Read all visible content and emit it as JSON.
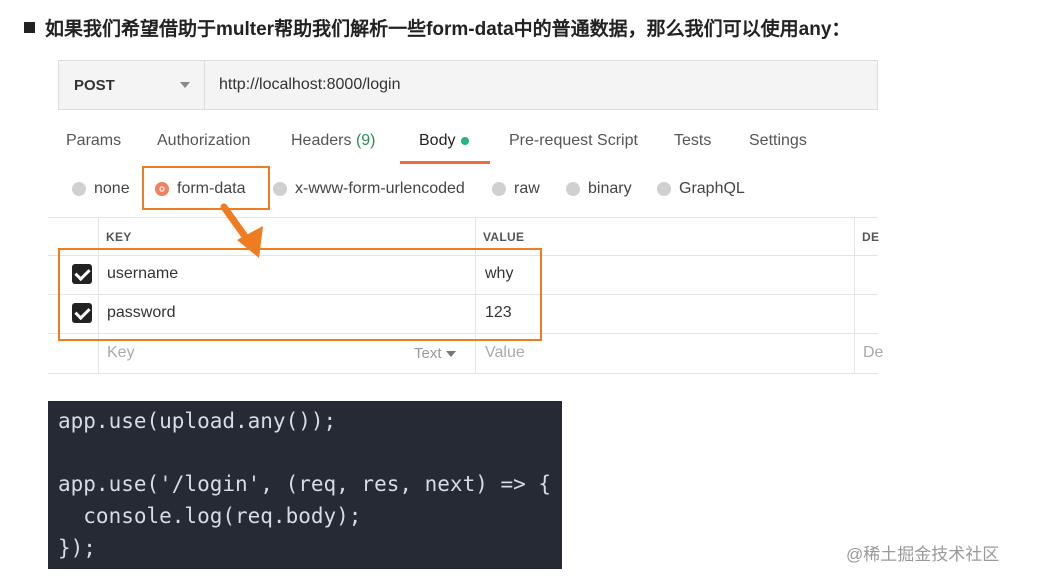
{
  "heading": "如果我们希望借助于multer帮助我们解析一些form-data中的普通数据，那么我们可以使用any：",
  "request": {
    "method": "POST",
    "url": "http://localhost:8000/login"
  },
  "tabs": [
    {
      "label": "Params"
    },
    {
      "label": "Authorization"
    },
    {
      "label": "Headers",
      "count": "(9)"
    },
    {
      "label": "Body",
      "active": true
    },
    {
      "label": "Pre-request Script"
    },
    {
      "label": "Tests"
    },
    {
      "label": "Settings"
    }
  ],
  "body_types": [
    "none",
    "form-data",
    "x-www-form-urlencoded",
    "raw",
    "binary",
    "GraphQL"
  ],
  "selected_body_type": "form-data",
  "table": {
    "headers": [
      "KEY",
      "VALUE",
      "DE"
    ],
    "rows": [
      {
        "key": "username",
        "value": "why",
        "checked": true
      },
      {
        "key": "password",
        "value": "123",
        "checked": true
      }
    ],
    "placeholder": {
      "key": "Key",
      "type": "Text",
      "value": "Value",
      "desc": "De"
    }
  },
  "code": {
    "line1": "app.use(upload.any());",
    "line2": "app.use('/login', (req, res, next) => {",
    "line3": "  console.log(req.body);",
    "line4": "});"
  },
  "watermark": "@稀土掘金技术社区",
  "colors": {
    "accent": "#f26b3a",
    "highlight": "#f07c20",
    "code_bg": "#262a35"
  }
}
